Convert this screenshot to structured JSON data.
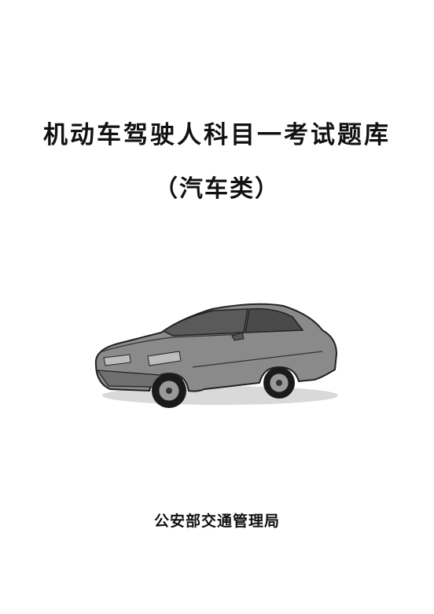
{
  "cover": {
    "title": "机动车驾驶人科目一考试题库",
    "subtitle": "（汽车类）",
    "publisher": "公安部交通管理局"
  }
}
